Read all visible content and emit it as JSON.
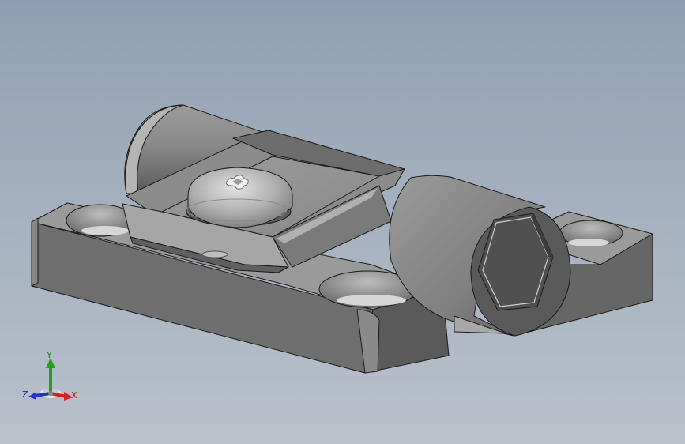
{
  "triad": {
    "x_label": "X",
    "y_label": "Y",
    "z_label": "Z",
    "x_color": "#d42020",
    "y_color": "#1fa21f",
    "z_color": "#2233cc"
  },
  "colors": {
    "background_top": "#8f9fb3",
    "background_bottom": "#b9c1cb",
    "model_base": "#6e6e6e",
    "model_edge": "#1a1a1a"
  }
}
